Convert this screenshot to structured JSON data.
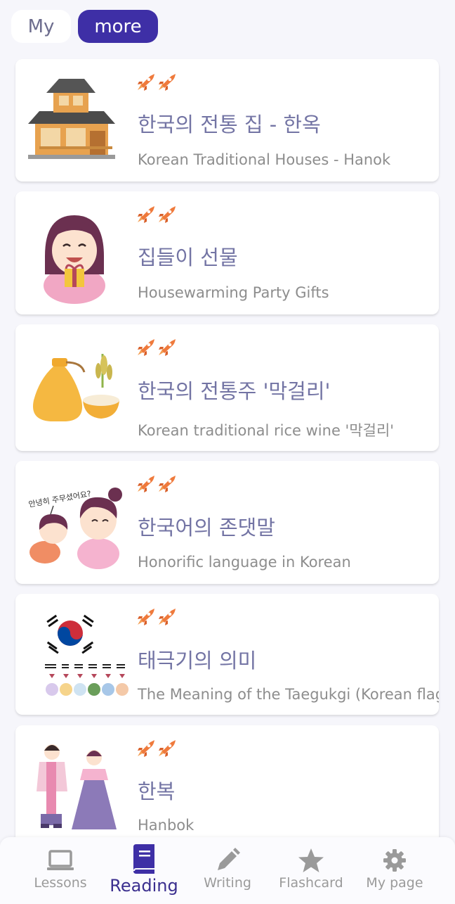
{
  "top_tabs": {
    "my": "My",
    "more": "more"
  },
  "cards": [
    {
      "title": "한국의 전통 집 - 한옥",
      "subtitle": "Korean Traditional Houses - Hanok",
      "icon": "hanok-house-icon"
    },
    {
      "title": "집들이 선물",
      "subtitle": "Housewarming Party Gifts",
      "icon": "girl-gift-icon"
    },
    {
      "title": "한국의 전통주 '막걸리'",
      "subtitle": "Korean traditional rice wine '막걸리'",
      "icon": "makgeolli-icon"
    },
    {
      "title": "한국어의 존댓말",
      "subtitle": "Honorific language in Korean",
      "icon": "honorific-greeting-icon",
      "speech": "안녕히 주무셨어요?"
    },
    {
      "title": "태극기의 의미",
      "subtitle": "The Meaning of the Taegukgi (Korean flag)",
      "icon": "taegukgi-icon"
    },
    {
      "title": "한복",
      "subtitle": "Hanbok",
      "icon": "hanbok-couple-icon"
    }
  ],
  "difficulty_icon": "rocket-icon",
  "bottom_nav": [
    {
      "label": "Lessons",
      "icon": "laptop-icon",
      "active": false
    },
    {
      "label": "Reading",
      "icon": "book-icon",
      "active": true
    },
    {
      "label": "Writing",
      "icon": "pencil-icon",
      "active": false
    },
    {
      "label": "Flashcard",
      "icon": "star-icon",
      "active": false
    },
    {
      "label": "My page",
      "icon": "gear-icon",
      "active": false
    }
  ],
  "colors": {
    "accent": "#3e2fa6",
    "title": "#7374a4",
    "subtitle": "#8d8d8d",
    "rocket": "#ef7a3c"
  }
}
